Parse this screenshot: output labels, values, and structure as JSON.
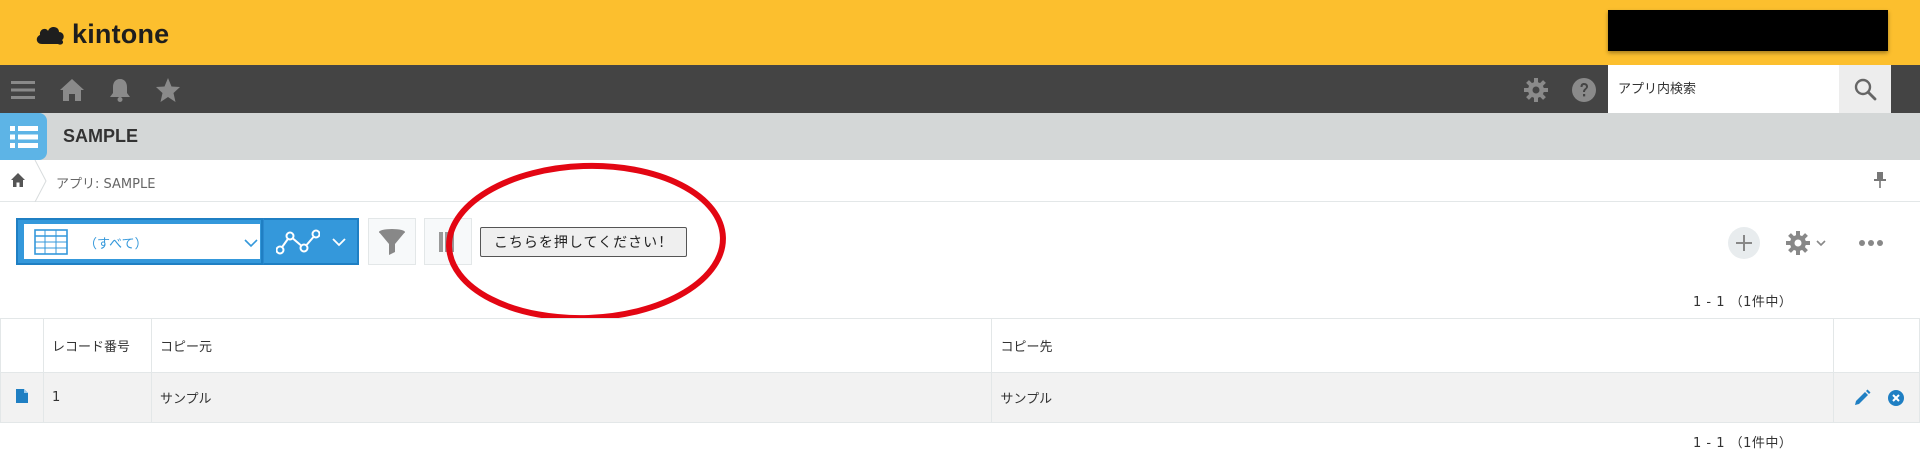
{
  "header": {
    "logo_text": "kintone",
    "brand_color": "#fcbf2e"
  },
  "nav": {
    "icons": [
      "menu-icon",
      "home-icon",
      "bell-icon",
      "star-icon"
    ],
    "right_icons": [
      "gear-icon",
      "help-icon"
    ],
    "search_placeholder": "アプリ内検索"
  },
  "app": {
    "title": "SAMPLE",
    "icon": "list-icon"
  },
  "breadcrumb": {
    "text": "アプリ: SAMPLE"
  },
  "toolbar": {
    "view_label": "（すべて）",
    "custom_button_label": "こちらを押してください！",
    "accent_color": "#3498db"
  },
  "pager": {
    "top": "1 - 1 （1件中）",
    "bottom": "1 - 1 （1件中）"
  },
  "table": {
    "columns": [
      "",
      "レコード番号",
      "コピー元",
      "コピー先",
      ""
    ],
    "rows": [
      {
        "record_number": "1",
        "copy_source": "サンプル",
        "copy_destination": "サンプル"
      }
    ]
  },
  "annotation": {
    "ellipse_color": "#e30613"
  }
}
